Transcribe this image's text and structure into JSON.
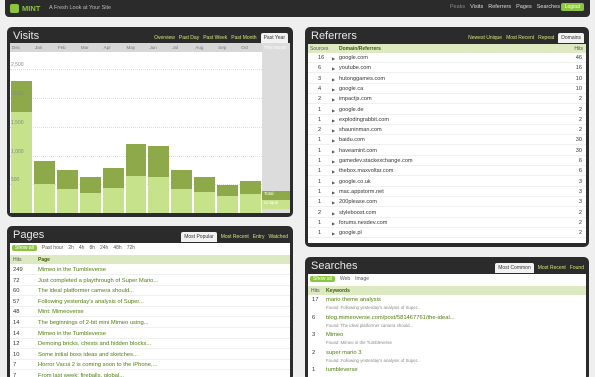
{
  "topbar": {
    "brand": "MINT",
    "tagline": "A Fresh Look at Your Site",
    "nav": [
      "Peaks",
      "Visits",
      "Referrers",
      "Pages",
      "Searches"
    ],
    "logout": "Logout"
  },
  "visits": {
    "title": "Visits",
    "tabs": [
      "Overview",
      "Past Day",
      "Past Week",
      "Past Month",
      "Past Year"
    ],
    "active_tab": "Past Year",
    "this_month_label": "This Month",
    "total_label": "Total",
    "unique_label": "Unique"
  },
  "chart_data": {
    "type": "bar",
    "categories": [
      "Dec",
      "Jan",
      "Feb",
      "Mar",
      "Apr",
      "May",
      "Jun",
      "Jul",
      "Aug",
      "Sep",
      "Oct",
      "This Month"
    ],
    "series": [
      {
        "name": "Total",
        "values": [
          2300,
          900,
          740,
          620,
          780,
          1200,
          1170,
          740,
          620,
          480,
          560,
          0
        ]
      },
      {
        "name": "Unique",
        "values": [
          1750,
          500,
          420,
          350,
          430,
          650,
          620,
          420,
          360,
          290,
          330,
          0
        ]
      }
    ],
    "yticks": [
      "500",
      "1,000",
      "1,500",
      "2,000",
      "2,500"
    ],
    "ylim": [
      0,
      2800
    ],
    "colors": {
      "total": "#8da94a",
      "unique": "#c6e28a"
    }
  },
  "referrers": {
    "title": "Referrers",
    "tabs": [
      "Newest Unique",
      "Most Recent",
      "Repeat",
      "Domains"
    ],
    "active_tab": "Domains",
    "col_sources": "Sources",
    "col_domain": "Domain/Referrers",
    "col_hits": "Hits",
    "rows": [
      {
        "sources": "16",
        "domain": "google.com",
        "hits": "46"
      },
      {
        "sources": "6",
        "domain": "youtube.com",
        "hits": "16"
      },
      {
        "sources": "3",
        "domain": "hutonggames.com",
        "hits": "10"
      },
      {
        "sources": "4",
        "domain": "google.ca",
        "hits": "10"
      },
      {
        "sources": "2",
        "domain": "impactjs.com",
        "hits": "2"
      },
      {
        "sources": "1",
        "domain": "google.de",
        "hits": "2"
      },
      {
        "sources": "1",
        "domain": "explodingrabbit.com",
        "hits": "2"
      },
      {
        "sources": "2",
        "domain": "shauninman.com",
        "hits": "2"
      },
      {
        "sources": "1",
        "domain": "baidu.com",
        "hits": "30"
      },
      {
        "sources": "1",
        "domain": "haveamint.com",
        "hits": "30"
      },
      {
        "sources": "1",
        "domain": "gamedev.stackexchange.com",
        "hits": "6"
      },
      {
        "sources": "1",
        "domain": "thebox.maxvoltar.com",
        "hits": "6"
      },
      {
        "sources": "1",
        "domain": "google.co.uk",
        "hits": "3"
      },
      {
        "sources": "1",
        "domain": "mac.appstorm.net",
        "hits": "3"
      },
      {
        "sources": "1",
        "domain": "200please.com",
        "hits": "3"
      },
      {
        "sources": "2",
        "domain": "styleboost.com",
        "hits": "2"
      },
      {
        "sources": "1",
        "domain": "forums.nesdev.com",
        "hits": "2"
      },
      {
        "sources": "1",
        "domain": "google.pl",
        "hits": "2"
      }
    ]
  },
  "pages": {
    "title": "Pages",
    "tabs": [
      "Most Popular",
      "Most Recent",
      "Entry",
      "Watched"
    ],
    "active_tab": "Most Popular",
    "filters": [
      "Show all",
      "Past hour",
      "2h",
      "4h",
      "8h",
      "24h",
      "48h",
      "72h"
    ],
    "col_hits": "Hits",
    "col_page": "Page",
    "rows": [
      {
        "hits": "249",
        "page": "Mimeo in the Tumbleverse"
      },
      {
        "hits": "72",
        "page": "Just completed a playthrough of Super Mario..."
      },
      {
        "hits": "60",
        "page": "The ideal platformer camera should..."
      },
      {
        "hits": "57",
        "page": "Following yesterday's analysis of Super..."
      },
      {
        "hits": "48",
        "page": "Mint: Mimeoverse"
      },
      {
        "hits": "14",
        "page": "The beginnings of 2-bit mini Mimeo using..."
      },
      {
        "hits": "14",
        "page": "Mimeo in the Tumbleverse"
      },
      {
        "hits": "12",
        "page": "Demoing bricks, chests and hidden blocks..."
      },
      {
        "hits": "10",
        "page": "Some initial boss ideas and sketches..."
      },
      {
        "hits": "7",
        "page": "Horror Vacui 2 is coming soon to the iPhone,..."
      },
      {
        "hits": "7",
        "page": "From last week: fireballs, global..."
      }
    ]
  },
  "searches": {
    "title": "Searches",
    "tabs": [
      "Most Common",
      "Most Recent",
      "Found"
    ],
    "active_tab": "Most Common",
    "filters": [
      "Show all",
      "Web",
      "Image"
    ],
    "col_hits": "Hits",
    "col_keywords": "Keywords",
    "found_prefix": "Found",
    "rows": [
      {
        "hits": "17",
        "keyword": "mario theme analysis",
        "found": "Following yesterday's analysis of Super..."
      },
      {
        "hits": "6",
        "keyword": "blog.mimeoverse.com/post/581467761/the-ideal...",
        "found": "The ideal platformer camera should..."
      },
      {
        "hits": "3",
        "keyword": "Mimeo",
        "found": "Mimeo in the Tumbleverse"
      },
      {
        "hits": "2",
        "keyword": "super mario 3",
        "found": "Following yesterday's analysis of Super..."
      },
      {
        "hits": "1",
        "keyword": "tumbleverse",
        "found": ""
      }
    ]
  }
}
